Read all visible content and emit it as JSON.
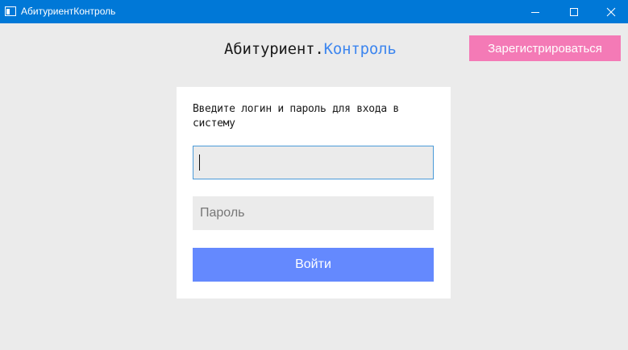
{
  "window": {
    "title": "АбитуриентКонтроль",
    "controls": {
      "minimize_icon": "minimize-icon",
      "maximize_icon": "maximize-icon",
      "close_icon": "close-icon"
    }
  },
  "header": {
    "brand_part1": "Абитуриент.",
    "brand_part2": "Контроль",
    "register_label": "Зарегистрироваться"
  },
  "login_card": {
    "prompt": "Введите логин и пароль для входа в систему",
    "login_value": "",
    "password_placeholder": "Пароль",
    "submit_label": "Войти"
  },
  "colors": {
    "titlebar": "#0078d7",
    "brand_accent": "#3d86ef",
    "register_button": "#f47ab6",
    "submit_button": "#6489fe",
    "background": "#ebebeb"
  }
}
